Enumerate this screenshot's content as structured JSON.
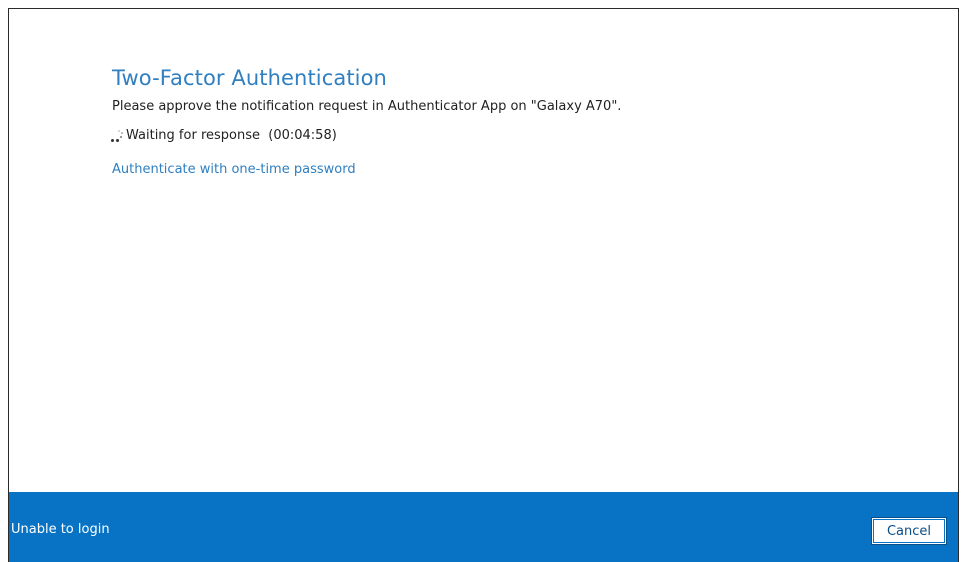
{
  "dialog": {
    "title": "Two-Factor Authentication",
    "message": "Please approve the notification request in Authenticator App on \"Galaxy A70\".",
    "status": {
      "label": "Waiting for response",
      "timer": "(00:04:58)"
    },
    "otp_link": "Authenticate with one-time password"
  },
  "footer": {
    "unable_link": "Unable to login",
    "cancel_label": "Cancel"
  },
  "colors": {
    "accent": "#2f7fc1",
    "footer_bg": "#0873c4"
  }
}
